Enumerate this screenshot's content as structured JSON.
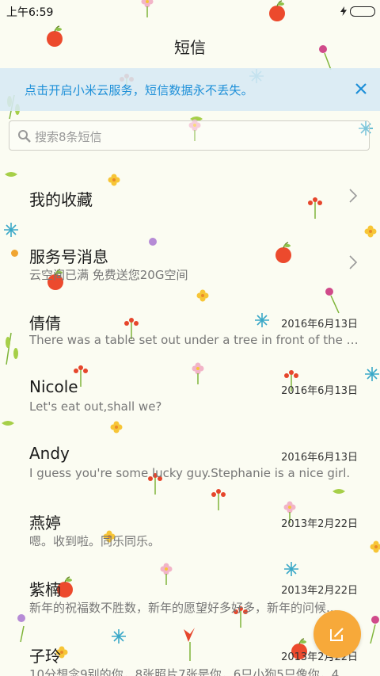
{
  "status_bar": {
    "time": "上午6:59"
  },
  "app": {
    "title": "短信"
  },
  "banner": {
    "text": "点击开启小米云服务，短信数据永不丢失。"
  },
  "search": {
    "placeholder": "搜索8条短信"
  },
  "conversations": [
    {
      "name": "我的收藏",
      "preview": "",
      "date": ""
    },
    {
      "name": "服务号消息",
      "preview": "云空间已满 免费送您20G空间",
      "date": "",
      "unread": true
    },
    {
      "name": "倩倩",
      "preview": "There was a table set out under a tree in front of the ho...",
      "date": "2016年6月13日"
    },
    {
      "name": "Nicole",
      "preview": "Let's eat out,shall we?",
      "date": "2016年6月13日"
    },
    {
      "name": "Andy",
      "preview": "I guess you're some lucky guy.Stephanie is a nice girl.",
      "date": "2016年6月13日"
    },
    {
      "name": "燕婷",
      "preview": "嗯。收到啦。同乐同乐。",
      "date": "2013年2月22日"
    },
    {
      "name": "紫楠",
      "preview": "新年的祝福数不胜数，新年的愿望好多好多，新年的问候...",
      "date": "2013年2月22日"
    },
    {
      "name": "子玲",
      "preview": "10分想念9别的你，8张照片7张是你，6只小狗5只像你，4...",
      "date": "2013年2月22日"
    }
  ],
  "colors": {
    "accent": "#1d8fd8",
    "fab": "#f7a93a",
    "unread_dot": "#f0a532",
    "banner_bg": "#d7e9f4"
  },
  "icons": {
    "search": "search-icon",
    "close": "close-icon",
    "compose": "compose-icon",
    "chevron": "chevron-right-icon"
  }
}
